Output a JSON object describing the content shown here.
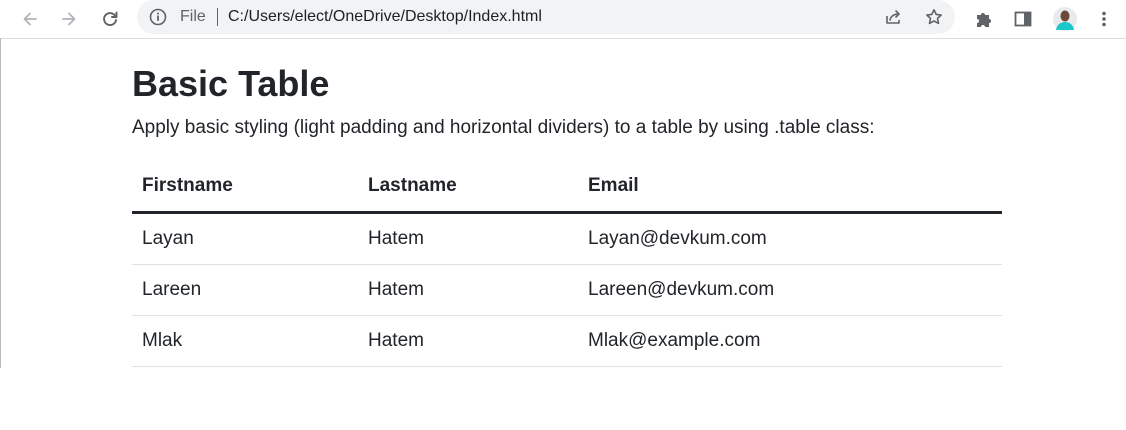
{
  "browser": {
    "omnibox": {
      "scheme_label": "File",
      "url": "C:/Users/elect/OneDrive/Desktop/Index.html"
    },
    "icons": {
      "back": "back-arrow-icon",
      "forward": "forward-arrow-icon",
      "reload": "reload-icon",
      "info": "info-icon",
      "share": "share-icon",
      "bookmark": "star-icon",
      "extensions": "puzzle-icon",
      "side_panel": "side-panel-icon",
      "profile": "avatar",
      "menu": "kebab-menu-icon"
    }
  },
  "page": {
    "title": "Basic Table",
    "description": "Apply basic styling (light padding and horizontal dividers) to a table by using .table class:",
    "table": {
      "headers": [
        "Firstname",
        "Lastname",
        "Email"
      ],
      "rows": [
        [
          "Layan",
          "Hatem",
          "Layan@devkum.com"
        ],
        [
          "Lareen",
          "Hatem",
          "Lareen@devkum.com"
        ],
        [
          "Mlak",
          "Hatem",
          "Mlak@example.com"
        ]
      ]
    }
  },
  "colors": {
    "text": "#212529",
    "omnibox_bg": "#f1f3f4",
    "divider": "#dee2e6",
    "icon_gray": "#5f6368"
  }
}
